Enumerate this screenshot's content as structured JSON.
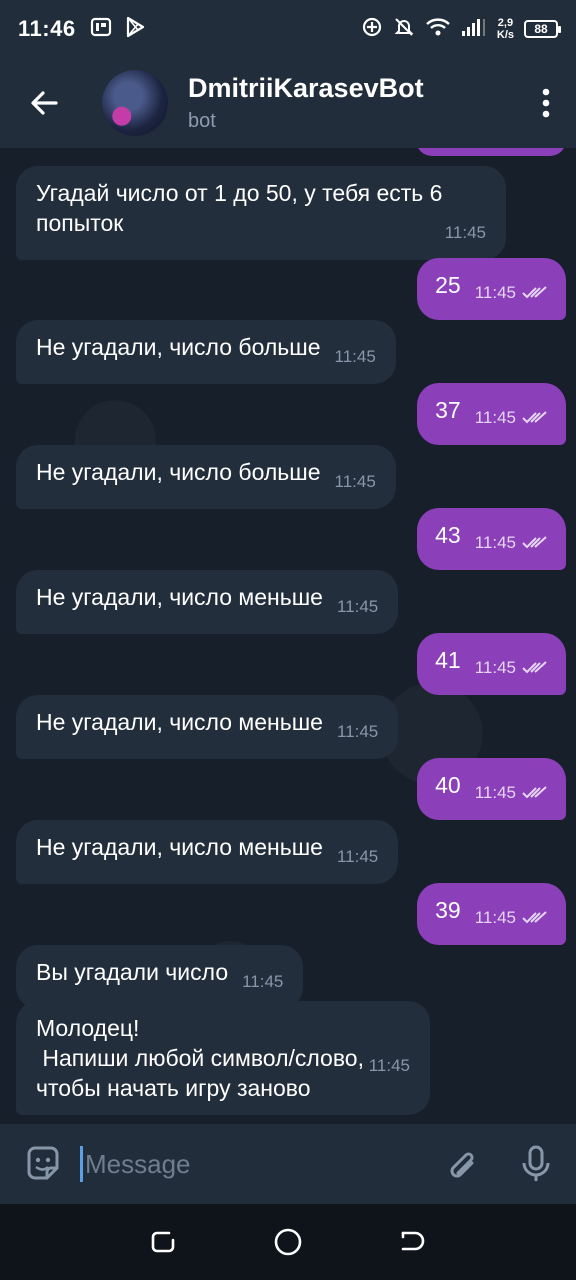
{
  "status_bar": {
    "time": "11:46",
    "net_speed_value": "2,9",
    "net_speed_unit": "K/s",
    "battery": "88"
  },
  "header": {
    "title": "DmitriiKarasevBot",
    "subtitle": "bot"
  },
  "messages": [
    {
      "side": "in",
      "text": "Угадай число от 1 до 50, у тебя есть 6\nпопыток",
      "time": "11:45"
    },
    {
      "side": "out",
      "text": "25",
      "time": "11:45"
    },
    {
      "side": "in",
      "text": "Не угадали, число больше",
      "time": "11:45"
    },
    {
      "side": "out",
      "text": "37",
      "time": "11:45"
    },
    {
      "side": "in",
      "text": "Не угадали, число больше",
      "time": "11:45"
    },
    {
      "side": "out",
      "text": "43",
      "time": "11:45"
    },
    {
      "side": "in",
      "text": "Не угадали, число меньше",
      "time": "11:45"
    },
    {
      "side": "out",
      "text": "41",
      "time": "11:45"
    },
    {
      "side": "in",
      "text": "Не угадали, число меньше",
      "time": "11:45"
    },
    {
      "side": "out",
      "text": "40",
      "time": "11:45"
    },
    {
      "side": "in",
      "text": "Не угадали, число меньше",
      "time": "11:45"
    },
    {
      "side": "out",
      "text": "39",
      "time": "11:45"
    },
    {
      "side": "in",
      "text": "Вы угадали число",
      "time": "11:45"
    },
    {
      "side": "in",
      "text": "Молодец!\n Напиши любой символ/слово,\nчтобы начать игру заново",
      "time": "11:45"
    }
  ],
  "input": {
    "placeholder": "Message",
    "value": ""
  },
  "colors": {
    "outgoing_bubble": "#8b3fb8",
    "incoming_bubble": "#232e3c",
    "header_bg": "#212d3b",
    "chat_bg": "#171f2b"
  },
  "icons": {
    "back": "arrow-left-icon",
    "menu": "more-vertical-icon",
    "emoji": "sticker-icon",
    "attach": "paperclip-icon",
    "mic": "microphone-icon",
    "read": "double-check-icon"
  }
}
